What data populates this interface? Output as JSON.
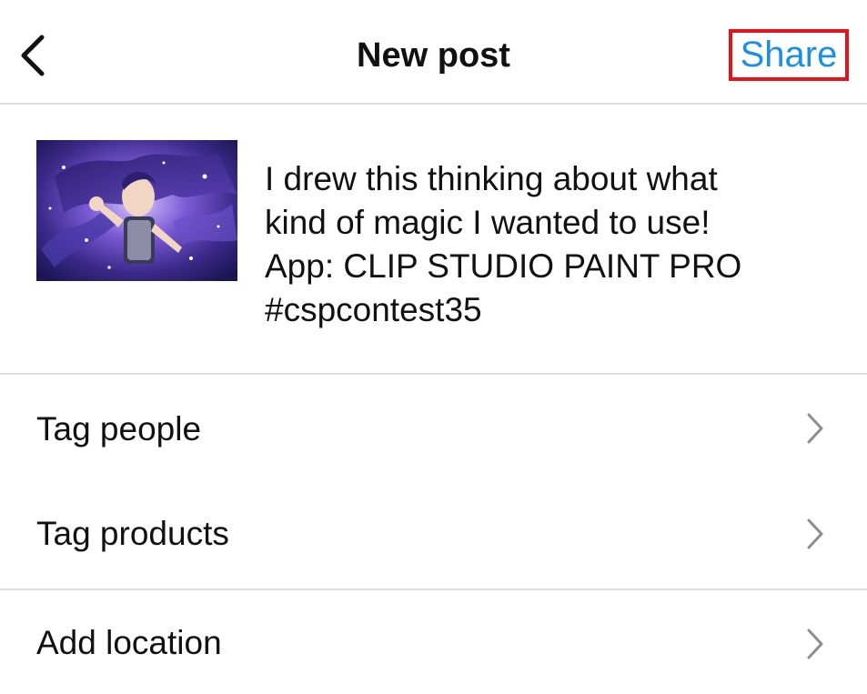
{
  "header": {
    "title": "New post",
    "share_label": "Share",
    "back_icon": "chevron-left-icon"
  },
  "compose": {
    "thumbnail_alt": "fantasy illustration of a magician girl with purple hair",
    "caption_lines": [
      "I drew this thinking about what",
      "kind of magic I wanted to use!",
      "App: CLIP STUDIO PAINT PRO",
      "#cspcontest35"
    ]
  },
  "options": [
    {
      "label": "Tag people",
      "icon": "chevron-right-icon"
    },
    {
      "label": "Tag products",
      "icon": "chevron-right-icon"
    },
    {
      "label": "Add location",
      "icon": "chevron-right-icon"
    }
  ],
  "colors": {
    "share": "#1a8fe3",
    "highlight_box": "#e8121b",
    "divider": "#dcdcdc",
    "chevron": "#8e8e8e"
  }
}
